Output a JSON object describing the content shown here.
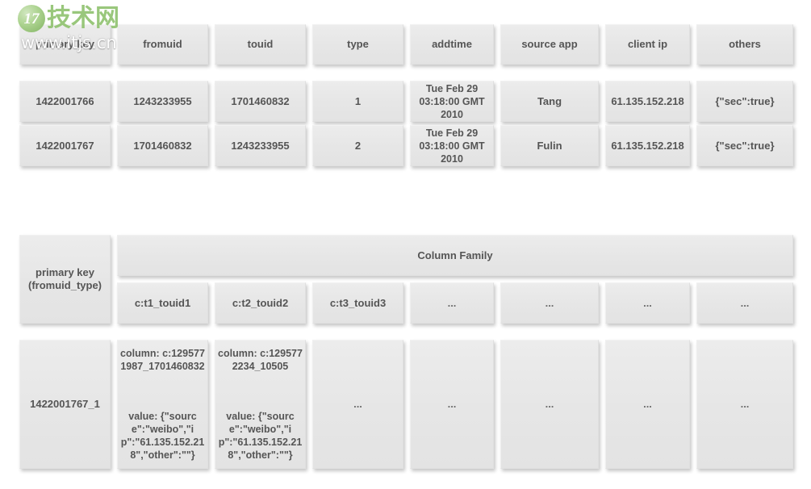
{
  "watermark": {
    "badge": "17",
    "brand": "技术网",
    "url": "www.itjs.cn"
  },
  "relational_table": {
    "headers": [
      "primary key",
      "fromuid",
      "touid",
      "type",
      "addtime",
      "source app",
      "client ip",
      "others"
    ],
    "rows": [
      [
        "1422001766",
        "1243233955",
        "1701460832",
        "1",
        "Tue Feb 29 03:18:00 GMT 2010",
        "Tang",
        "61.135.152.218",
        "{\"sec\":true}"
      ],
      [
        "1422001767",
        "1701460832",
        "1243233955",
        "2",
        "Tue Feb 29 03:18:00 GMT 2010",
        "Fulin",
        "61.135.152.218",
        "{\"sec\":true}"
      ]
    ]
  },
  "hbase_table": {
    "row_key_header": "primary key\n(fromuid_type)",
    "column_family_header": "Column Family",
    "qualifiers": [
      "c:t1_touid1",
      "c:t2_touid2",
      "c:t3_touid3",
      "...",
      "...",
      "...",
      "..."
    ],
    "row": {
      "row_key": "1422001767_1",
      "cells": [
        {
          "column": "column: c:1295771987_1701460832",
          "value": "value: {\"source\":\"weibo\",\"ip\":\"61.135.152.218\",\"other\":\"\"}"
        },
        {
          "column": "column: c:1295772234_10505",
          "value": "value: {\"source\":\"weibo\",\"ip\":\"61.135.152.218\",\"other\":\"\"}"
        },
        {
          "column": "...",
          "value": ""
        },
        {
          "column": "...",
          "value": ""
        },
        {
          "column": "...",
          "value": ""
        },
        {
          "column": "...",
          "value": ""
        },
        {
          "column": "...",
          "value": ""
        }
      ]
    }
  },
  "colors": {
    "cell_fill": "#e8e8e8",
    "text": "#555555",
    "page_background": "#ffffff",
    "brand_green": "#8cc06a"
  }
}
